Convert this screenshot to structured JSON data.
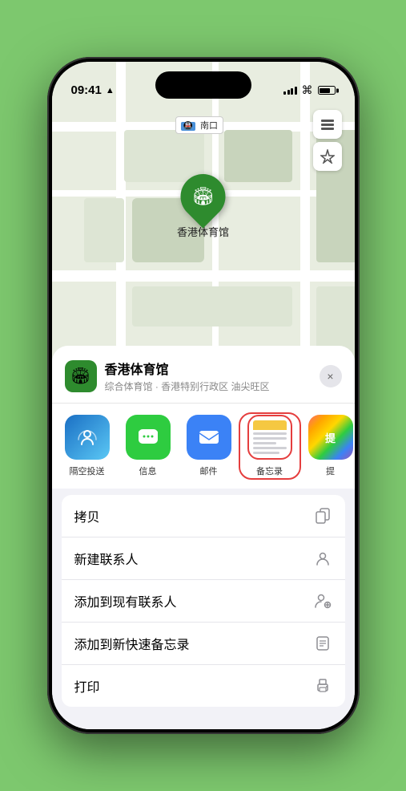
{
  "status_bar": {
    "time": "09:41",
    "location_arrow": "▲"
  },
  "map": {
    "label": "南口",
    "stadium_name": "香港体育馆"
  },
  "location_card": {
    "name": "香港体育馆",
    "subtitle": "综合体育馆 · 香港特别行政区 油尖旺区",
    "close_label": "×"
  },
  "share_items": [
    {
      "id": "airdrop",
      "label": "隔空投送"
    },
    {
      "id": "messages",
      "label": "信息"
    },
    {
      "id": "mail",
      "label": "邮件"
    },
    {
      "id": "notes",
      "label": "备忘录"
    },
    {
      "id": "more",
      "label": "提"
    }
  ],
  "actions": [
    {
      "label": "拷贝",
      "icon": "copy"
    },
    {
      "label": "新建联系人",
      "icon": "person"
    },
    {
      "label": "添加到现有联系人",
      "icon": "person-add"
    },
    {
      "label": "添加到新快速备忘录",
      "icon": "note"
    },
    {
      "label": "打印",
      "icon": "print"
    }
  ]
}
